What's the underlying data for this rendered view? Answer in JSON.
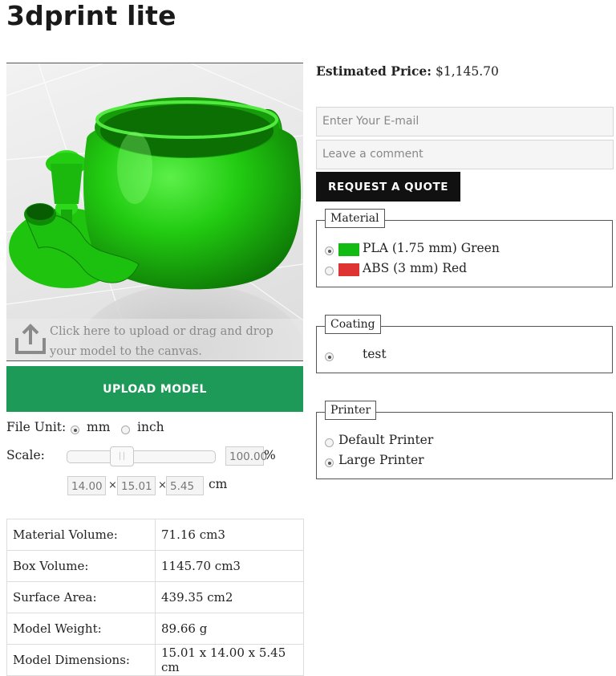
{
  "page": {
    "title": "3dprint lite"
  },
  "viewer": {
    "upload_hint": "Click here to upload or drag and drop your model to the canvas.",
    "model_color": "#22cc11"
  },
  "upload_button": "UPLOAD MODEL",
  "file_unit": {
    "label": "File Unit:",
    "options": [
      "mm",
      "inch"
    ],
    "selected": "mm"
  },
  "scale": {
    "label": "Scale:",
    "value": "100.00",
    "suffix": "%",
    "slider_fraction": 0.35
  },
  "dimensions": {
    "x": "14.00",
    "y": "15.01",
    "z": "5.45",
    "separator": "×",
    "unit": "cm"
  },
  "stats": [
    {
      "label": "Material Volume:",
      "value": "71.16 cm3"
    },
    {
      "label": "Box Volume:",
      "value": "1145.70 cm3"
    },
    {
      "label": "Surface Area:",
      "value": "439.35 cm2"
    },
    {
      "label": "Model Weight:",
      "value": "89.66 g"
    },
    {
      "label": "Model Dimensions:",
      "value": "15.01 x 14.00 x 5.45 cm"
    }
  ],
  "estimate": {
    "label": "Estimated Price:",
    "value": "$1,145.70"
  },
  "quote_form": {
    "email_placeholder": "Enter Your E-mail",
    "comment_placeholder": "Leave a comment",
    "button": "REQUEST A QUOTE"
  },
  "material": {
    "legend": "Material",
    "options": [
      {
        "label": "PLA (1.75 mm) Green",
        "color": "#11bb11",
        "checked": true
      },
      {
        "label": "ABS (3 mm) Red",
        "color": "#dd3333",
        "checked": false
      }
    ]
  },
  "coating": {
    "legend": "Coating",
    "options": [
      {
        "label": "test",
        "checked": true
      }
    ]
  },
  "printer": {
    "legend": "Printer",
    "options": [
      {
        "label": "Default Printer",
        "checked": false
      },
      {
        "label": "Large Printer",
        "checked": true
      }
    ]
  }
}
